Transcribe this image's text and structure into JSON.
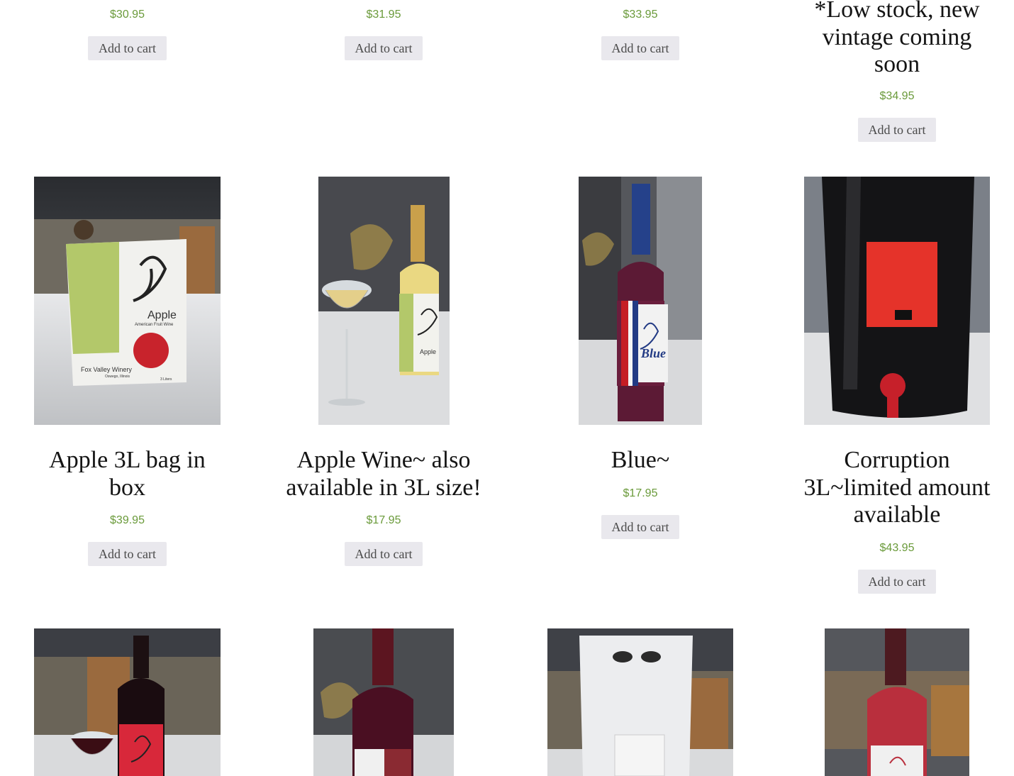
{
  "top_row": [
    {
      "price": "$30.95",
      "button": "Add to cart"
    },
    {
      "price": "$31.95",
      "button": "Add to cart"
    },
    {
      "price": "$33.95",
      "button": "Add to cart"
    },
    {
      "title": "*Low stock, new vintage coming soon",
      "price": "$34.95",
      "button": "Add to cart"
    }
  ],
  "products": [
    {
      "title": "Apple 3L bag in box",
      "price": "$39.95",
      "button": "Add to cart",
      "image_text": {
        "brand": "Apple",
        "sub": "American Fruit Wine",
        "winery": "Fox Valley Winery",
        "city": "Oswego, Illinois",
        "size": "3 Liters"
      }
    },
    {
      "title": "Apple Wine~ also available in 3L size!",
      "price": "$17.95",
      "button": "Add to cart",
      "image_text": {
        "brand": "Apple"
      }
    },
    {
      "title": "Blue~",
      "price": "$17.95",
      "button": "Add to cart",
      "image_text": {
        "brand": "Blue"
      }
    },
    {
      "title": "Corruption 3L~limited amount available",
      "price": "$43.95",
      "button": "Add to cart"
    }
  ],
  "colors": {
    "price": "#6a9a3a",
    "button_bg": "#e9e8ed"
  }
}
